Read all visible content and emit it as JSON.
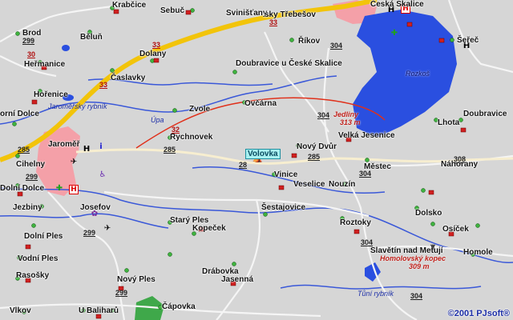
{
  "map": {
    "copyright": "©2001 PJsoft®",
    "towns": {
      "krabcice": "Krabčice",
      "sebuc": "Sebuč",
      "svinistany": "Svinišťany",
      "ceska_skalice": "Česká Skalice",
      "trebesov": "sky Třebešov",
      "brod": "Brod",
      "beluń": "Běluň",
      "rikov": "Říkov",
      "serec": "Šeřeč",
      "hermanice": "Heřmanice",
      "dolany": "Dolany",
      "doubravice_u_cs": "Doubravice u České Skalice",
      "caslavky": "Časlavky",
      "horenice": "Hořenice",
      "zvole": "Zvole",
      "ovcarna": "Ovčárna",
      "dolce": "orní Dolce",
      "lhota": "Lhota",
      "doubravice": "Doubravice",
      "rychnovek": "Rychnovek",
      "jaromer": "Jaroměř",
      "novy_dvur": "Nový Dvůr",
      "velka_jesenice": "Velká Jesenice",
      "cihelny": "Cihelny",
      "volovka": "Volovka",
      "mestec": "Městec",
      "nahorany": "Náhorany",
      "vinice": "Vinice",
      "veselice": "Veselice",
      "nouzin": "Nouzín",
      "dolni_dolce": "Dolní Dolce",
      "jezbiny": "Jezbiny",
      "josefov": "Josefov",
      "sestajovice": "Šestajovice",
      "dolsko": "Dolsko",
      "stary_ples": "Starý Ples",
      "kopecek": "Kopeček",
      "roztoky": "Roztoky",
      "osicek": "Osíček",
      "dolni_ples": "Dolní Ples",
      "slavetin": "Slavětín nad Metují",
      "homole": "Homole",
      "vodni_ples": "Vodní Ples",
      "rasosky": "Rasošky",
      "drabovka": "Drábovka",
      "jasenna": "Jasenná",
      "novy_ples": "Nový Ples",
      "vlkov": "Vlkov",
      "u_baliharu": "U Baliharů",
      "capovka": "Čápovka"
    },
    "water": {
      "rozkos": "Rozkoš",
      "upa": "Úpa",
      "jaromersky": "Jaroměřský rybník",
      "tuni": "Tůní rybník"
    },
    "hills": {
      "jedliny": "Jedliny",
      "jedliny_alt": "313 m",
      "homolovsky": "Homolovský kopec",
      "homolovsky_alt": "309 m"
    },
    "roads": {
      "r33a": "33",
      "r33b": "33",
      "r33c": "33",
      "r299a": "299",
      "r299b": "299",
      "r299c": "299",
      "r299d": "299",
      "r30": "30",
      "r32": "32",
      "r285a": "285",
      "r285b": "285",
      "r285c": "285",
      "r304a": "304",
      "r304b": "304",
      "r304c": "304",
      "r304d": "304",
      "r304e": "304",
      "r308": "308",
      "r28": "28"
    },
    "colors": {
      "background": "#d6d6d6",
      "major_road": "#f2c40a",
      "secondary_road": "#f5f5f5",
      "red_road": "#e0301a",
      "water": "#2a4fe0",
      "river": "#3a58d8",
      "town_area": "#f4a0a8",
      "forest": "#3fa84a"
    }
  }
}
